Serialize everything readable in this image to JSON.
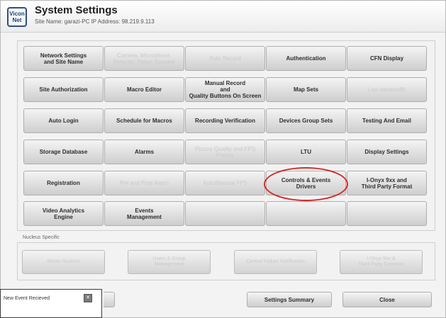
{
  "header": {
    "logo_text": "Vicon Net",
    "title": "System Settings",
    "subtitle": "Site Name: garazi-PC  IP Address: 98.219.9.113"
  },
  "grid": [
    [
      "Network Settings\nand Site Name",
      "Camera, Microphone,\nDetector, Relay, Speaker",
      "Auto Record",
      "Authentication",
      "CFN Display"
    ],
    [
      "Site Authorization",
      "Macro Editor",
      "Manual Record\nand\nQuality Buttons On Screen",
      "Map Sets",
      "Low bandwidth"
    ],
    [
      "Auto Login",
      "Schedule for Macros",
      "Recording Verification",
      "Devices Group Sets",
      "Testing And Email"
    ],
    [
      "Storage Database",
      "Alarms",
      "Picture Quality and FPS\nPriority",
      "LTU",
      "Display Settings"
    ],
    [
      "Registration",
      "Pre and Post Alarm",
      "Auto/Manual FPS",
      "Controls & Events\nDrivers",
      "I-Onyx 9xx and\nThird Party Format"
    ],
    [
      "Video Analytics\nEngine",
      "Events\nManagement",
      "",
      "",
      ""
    ]
  ],
  "nucleus": {
    "label": "Nucleus Specific",
    "buttons": [
      "Reset Nucleus",
      "Users & Group\nManagement",
      "Central Failure Notification",
      "I-Onyx 9xx &\nThird Party Cameras"
    ]
  },
  "footer": {
    "settings_summary": "Settings Summary",
    "close": "Close"
  },
  "toast": {
    "text": "New Event Recieved"
  }
}
